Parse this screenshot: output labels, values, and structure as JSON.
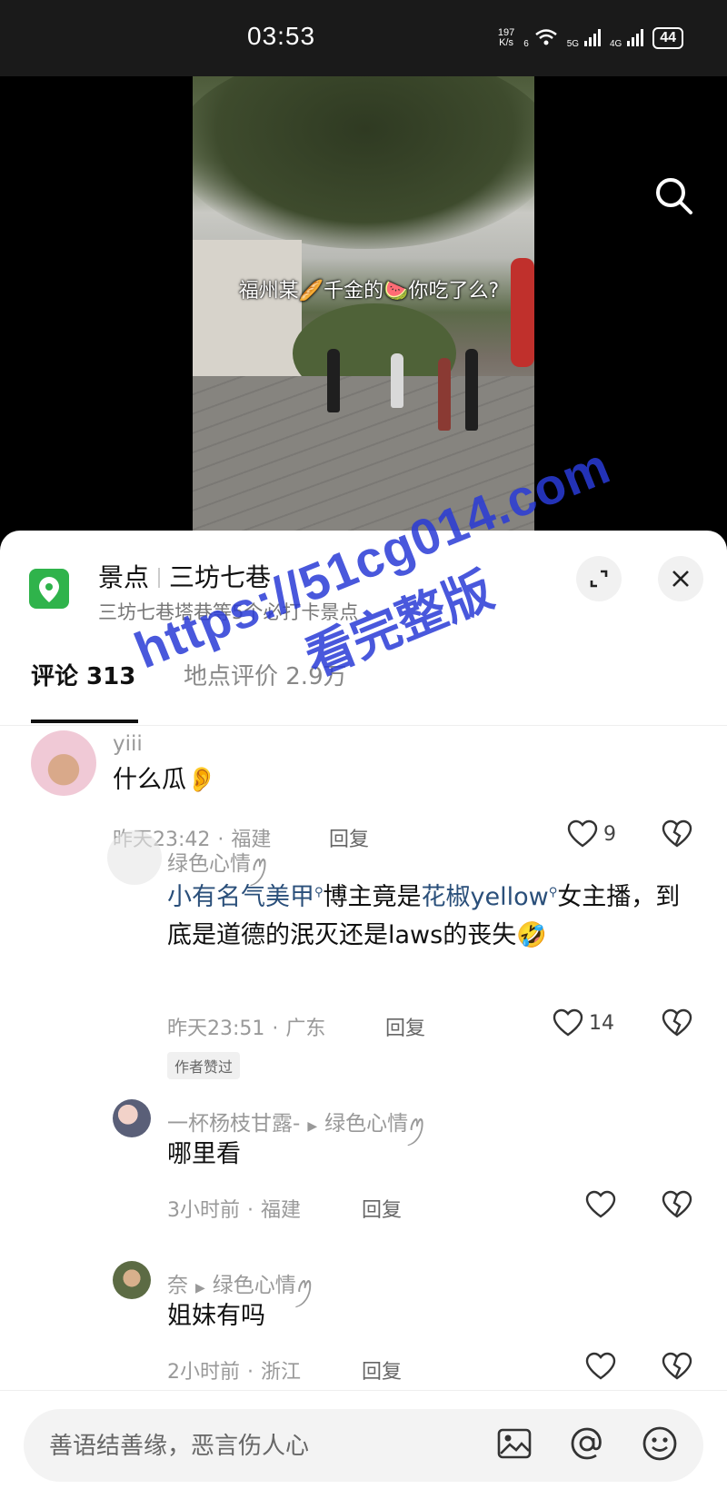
{
  "status_bar": {
    "time": "03:53",
    "net_speed_value": "197",
    "net_speed_unit": "K/s",
    "wifi_label": "6",
    "signal1_label": "5G",
    "signal2_label": "4G",
    "battery": "44"
  },
  "video": {
    "caption": "福州某🥖千金的🍉你吃了么?"
  },
  "location_sheet": {
    "category": "景点",
    "place_name": "三坊七巷",
    "subtitle": "三坊七巷塔巷等5个必打卡景点",
    "tabs": [
      {
        "label": "评论 313",
        "active": true
      },
      {
        "label": "地点评价 2.9万",
        "active": false
      }
    ]
  },
  "comments": [
    {
      "user": "yiii",
      "text": "什么瓜👂",
      "time": "昨天23:42",
      "location": "福建",
      "reply_label": "回复",
      "likes": "9"
    },
    {
      "user": "绿色心情ꪑ",
      "text_part1": "小有名气美甲",
      "text_part2": "博主竟是",
      "text_part3": "花椒yellow",
      "text_part4": "女主播，到底是道德的泯灭还是laws的丧失🤣",
      "time": "昨天23:51",
      "location": "广东",
      "reply_label": "回复",
      "likes": "14",
      "badge": "作者赞过"
    },
    {
      "user": "一杯杨枝甘露-",
      "reply_to": "绿色心情ꪑ",
      "text": "哪里看",
      "time": "3小时前",
      "location": "福建",
      "reply_label": "回复"
    },
    {
      "user": "奈",
      "reply_to": "绿色心情ꪑ",
      "text": "姐妹有吗",
      "time": "2小时前",
      "location": "浙江",
      "reply_label": "回复"
    }
  ],
  "watermark": {
    "url": "https://51cg014.com",
    "text": "看完整版"
  },
  "input": {
    "placeholder": "善语结善缘，恶言伤人心"
  },
  "colors": {
    "accent_green": "#2fb34b",
    "keyword_blue": "#2a4f7a",
    "watermark_blue": "#2a3bd6"
  }
}
